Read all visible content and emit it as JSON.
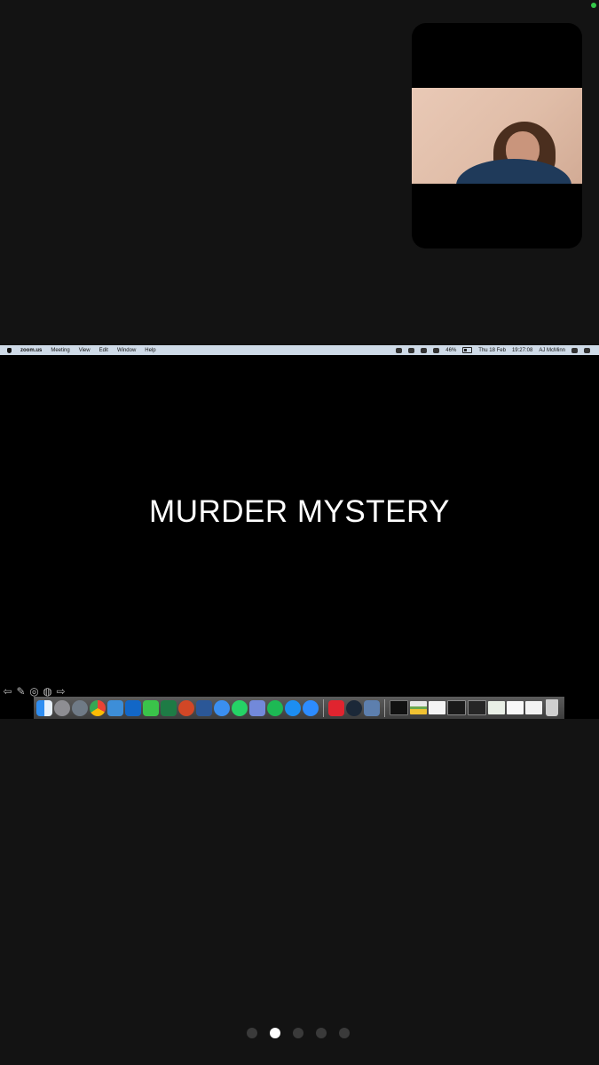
{
  "menubar": {
    "app": "zoom.us",
    "items": [
      "Meeting",
      "View",
      "Edit",
      "Window",
      "Help"
    ],
    "battery": "46%",
    "date": "Thu 18 Feb",
    "time": "19:27:08",
    "user": "AJ McMinn"
  },
  "slide": {
    "title": "MURDER MYSTERY"
  },
  "pager": {
    "count": 5,
    "active_index": 1
  },
  "colors": {
    "status_dot": "#33c748",
    "menubar": "#cfdbe8",
    "background": "#131313"
  }
}
